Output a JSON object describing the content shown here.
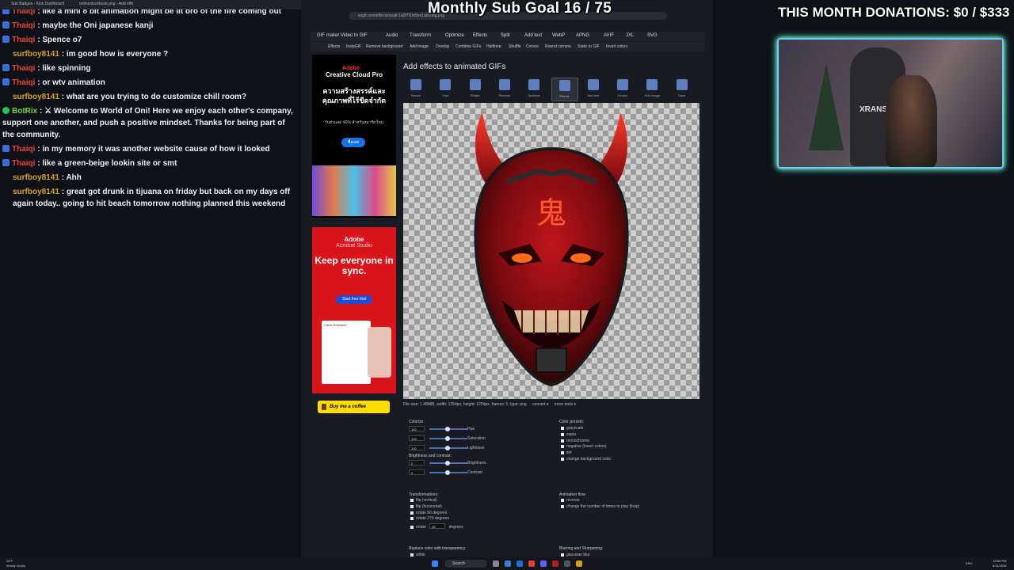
{
  "overlay": {
    "goal": "Monthly Sub Goal 16 / 75",
    "donations": "THIS MONTH DONATIONS: $0 / $333",
    "cam_chair_text": "XRANS"
  },
  "browser": {
    "tabs": [
      "Sub Badges - Kick Dashboard",
      "onlinestockbook.png - Add effe"
    ],
    "url": "ezgif.com/effects/ezgif-1a0f7f1fe5ee1a6cong.png"
  },
  "chat": [
    {
      "user": "Thaiqi",
      "color": "thaiqi",
      "icon": "badge",
      "text": "like a mini 8 bit animation might be lit bro of the fire coming out"
    },
    {
      "user": "Thaiqi",
      "color": "thaiqi",
      "icon": "badge",
      "text": "maybe the Oni japanese kanji"
    },
    {
      "user": "Thaiqi",
      "color": "thaiqi",
      "icon": "badge",
      "text": "Spence o7"
    },
    {
      "user": "surfboy8141",
      "color": "surf",
      "icon": "none",
      "text": "im good how is everyone ?"
    },
    {
      "user": "Thaiqi",
      "color": "thaiqi",
      "icon": "badge",
      "text": "like spinning"
    },
    {
      "user": "Thaiqi",
      "color": "thaiqi",
      "icon": "badge",
      "text": "or wtv animation"
    },
    {
      "user": "surfboy8141",
      "color": "surf",
      "icon": "none",
      "text": "what are you trying to do customize chill room?"
    },
    {
      "user": "BotRix",
      "color": "botrix",
      "icon": "bot",
      "text": "⚔ Welcome to World of Oni! Here we enjoy each other's company, support one another, and push a positive mindset. Thanks for being part of the community."
    },
    {
      "user": "Thaiqi",
      "color": "thaiqi",
      "icon": "badge",
      "text": "in my memory it was another website cause of how it looked"
    },
    {
      "user": "Thaiqi",
      "color": "thaiqi",
      "icon": "badge",
      "text": "like a green-beige lookin site or smt"
    },
    {
      "user": "surfboy8141",
      "color": "surf",
      "icon": "none",
      "text": "Ahh"
    },
    {
      "user": "surfboy8141",
      "color": "surf",
      "icon": "none",
      "text": "great got drunk in tijuana on friday but back on my days off again today.. going to hit beach tomorrow nothing planned this weekend"
    }
  ],
  "site": {
    "nav": [
      "GIF maker",
      "Video to GIF",
      "Audio",
      "Transform",
      "Optimize",
      "Effects",
      "Split",
      "Add text",
      "WebP",
      "APNG",
      "AVIF",
      "JXL",
      "SVG"
    ],
    "subnav": [
      "Effects",
      "InstaGIF",
      "Remove background",
      "Add image",
      "Overlay",
      "Combine GIFs",
      "Halftone",
      "Shuffle",
      "Censor",
      "Round corners",
      "Static to GIF",
      "Invert colors"
    ],
    "heading": "Add effects to animated GIFs",
    "tools": [
      "Resize",
      "Crop",
      "Rotate",
      "Reverse",
      "Optimize",
      "Effects",
      "Add text",
      "Censor",
      "Add image",
      "Save"
    ],
    "active_tool": 5,
    "kanji": "鬼",
    "fileinfo": "File size: 1.48MiB, width: 1254px, height: 1254px, frames: 1, type: png",
    "convert": "convert ▾",
    "more_tools": "more tools ▾",
    "coffee": "Buy me a coffee"
  },
  "ads": {
    "ad1": {
      "logo": "Adobe",
      "title": "Creative Cloud Pro",
      "thai": "ความสร้างสรรค์และคุณภาพที่ไร้ขีดจำกัด",
      "small": "รับส่วนลด 40% สำหรับสมาชิกใหม่",
      "button": "ซื้อเลย"
    },
    "ad2": {
      "logo": "Adobe",
      "sub": "Acrobat Studio",
      "title": "Keep everyone in sync.",
      "button": "Start free trial",
      "doc": "Client Research"
    }
  },
  "controls": {
    "colorize_label": "Colorize:",
    "colorize": [
      {
        "value": "100",
        "label": "Hue"
      },
      {
        "value": "100",
        "label": "Saturation"
      },
      {
        "value": "100",
        "label": "Lightness"
      }
    ],
    "brightness_label": "Brightness and contrast:",
    "brightness": [
      {
        "value": "0",
        "label": "Brightness"
      },
      {
        "value": "0",
        "label": "Contrast"
      }
    ],
    "presets_label": "Color presets:",
    "presets": [
      "grayscale",
      "sepia",
      "monochrome",
      "negative (invert colors)",
      "tint",
      "change background color"
    ],
    "transform_label": "Transformations:",
    "transform": [
      "flip (vertical)",
      "flip (horizontal)",
      "rotate 90 degrees",
      "rotate 270 degrees"
    ],
    "rotate_label": "rotate",
    "rotate_value": "45",
    "rotate_unit": "degrees",
    "flow_label": "Animation flow:",
    "flow": [
      "reverse",
      "change the number of times to play (loop)"
    ],
    "replace_label": "Replace color with transparency:",
    "replace_first": "white",
    "blur_label": "Blurring and Sharpening:",
    "blur_first": "gaussian blur"
  },
  "taskbar": {
    "weather": "28°F\nMostly cloudy",
    "search": "Search",
    "time": "10:53 PM",
    "date": "8/11/2026",
    "lang": "ENG"
  }
}
